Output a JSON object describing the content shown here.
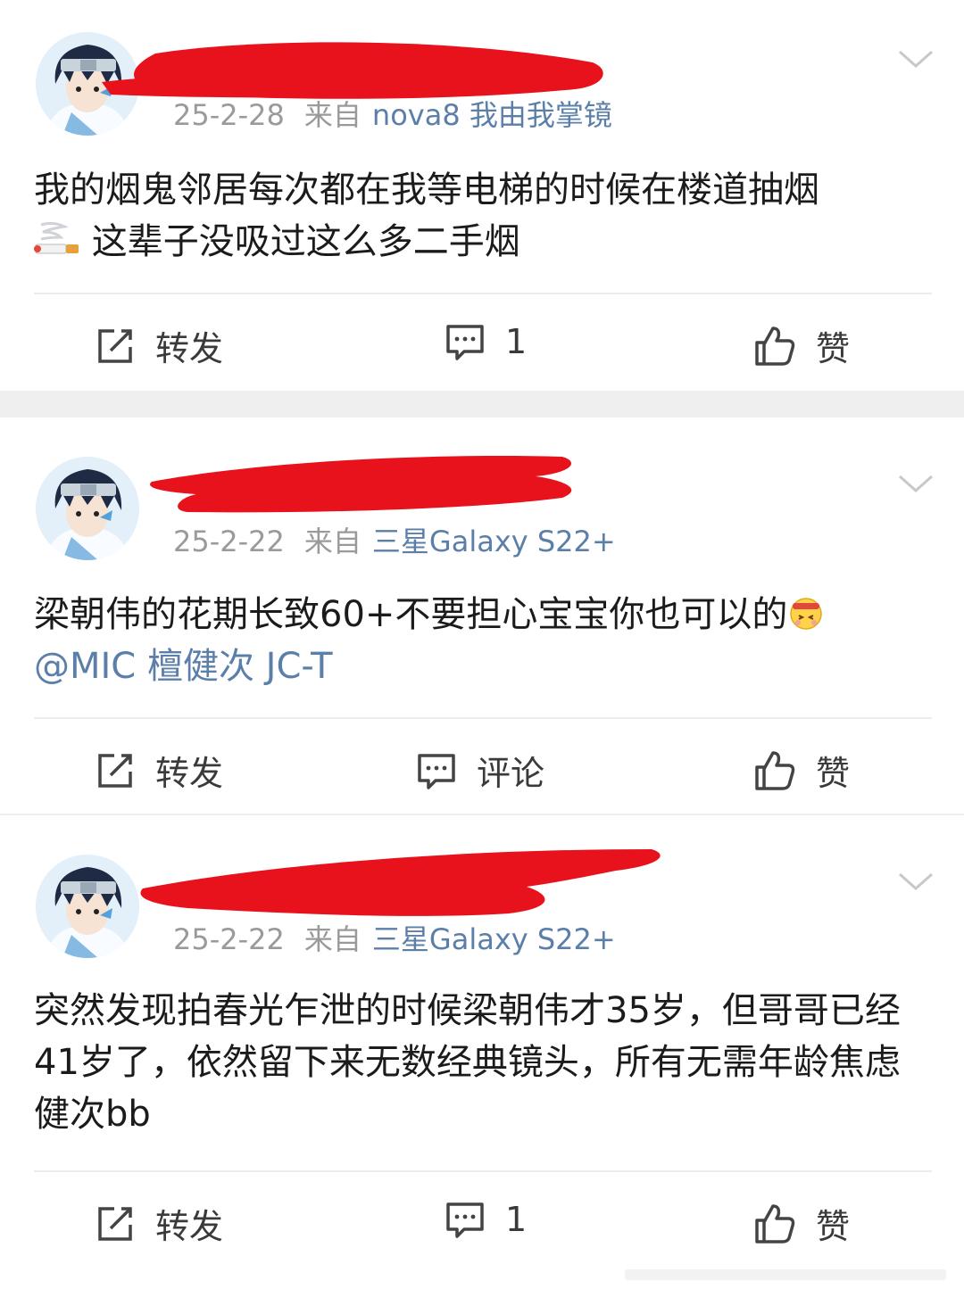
{
  "posts": [
    {
      "date": "25-2-28",
      "from_label": "来自",
      "source": "nova8 我由我掌镜",
      "text": "我的烟鬼邻居每次都在我等电梯的时候在楼道抽烟",
      "emoji_icon": "cigarette-emoji",
      "text2": " 这辈子没吸过这么多二手烟",
      "actions": {
        "repost": "转发",
        "comment": "1",
        "like": "赞"
      }
    },
    {
      "date": "25-2-22",
      "from_label": "来自",
      "source": "三星Galaxy S22+",
      "text": "梁朝伟的花期长致60+不要担心宝宝你也可以的",
      "emoji_icon": "cheer-face-emoji",
      "mention": "@MIC 檀健次 JC-T",
      "actions": {
        "repost": "转发",
        "comment": "评论",
        "like": "赞"
      }
    },
    {
      "date": "25-2-22",
      "from_label": "来自",
      "source": "三星Galaxy S22+",
      "text": "突然发现拍春光乍泄的时候梁朝伟才35岁，但哥哥已经41岁了，依然留下来无数经典镜头，所有无需年龄焦虑健次bb",
      "actions": {
        "repost": "转发",
        "comment": "1",
        "like": "赞"
      }
    }
  ],
  "icons": {
    "repost": "repost-icon",
    "comment": "comment-icon",
    "like": "thumbs-up-icon",
    "more": "chevron-down-icon"
  },
  "colors": {
    "link": "#5b7fa9",
    "meta": "#9a9a9a",
    "redaction": "#e8121c",
    "separator": "#efefef"
  }
}
